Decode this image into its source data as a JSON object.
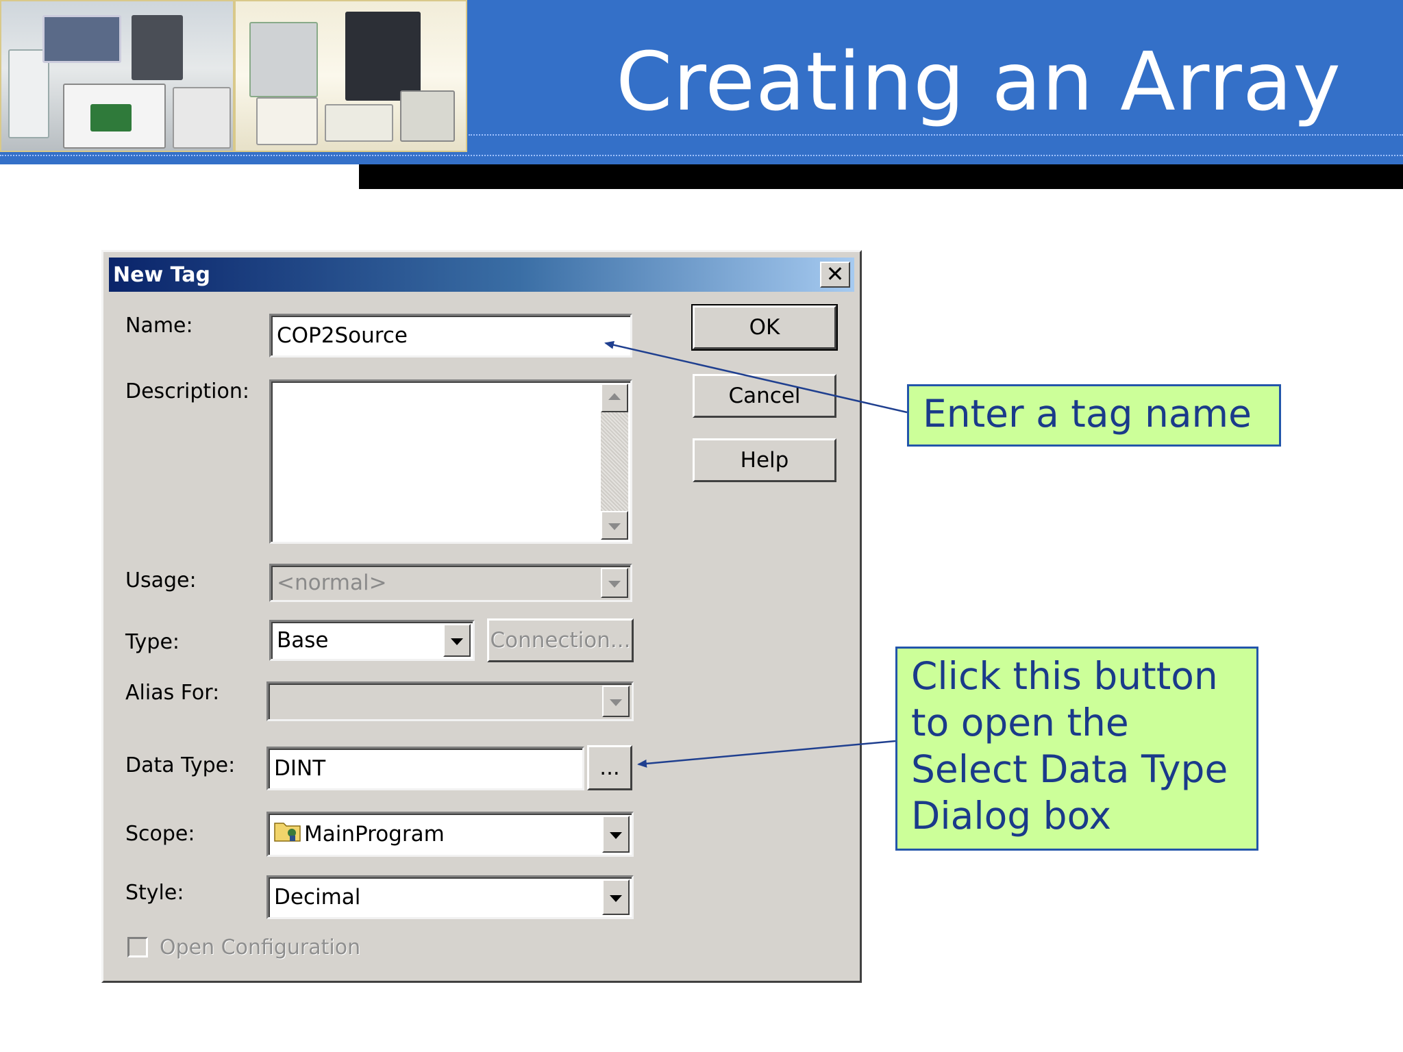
{
  "slide": {
    "title": "Creating an Array"
  },
  "dialog": {
    "title": "New Tag",
    "close_glyph": "✕",
    "labels": {
      "name": "Name:",
      "description": "Description:",
      "usage": "Usage:",
      "type": "Type:",
      "alias_for": "Alias For:",
      "data_type": "Data Type:",
      "scope": "Scope:",
      "style": "Style:"
    },
    "fields": {
      "name_value": "COP2Source",
      "description_value": "",
      "usage_value": "<normal>",
      "type_value": "Base",
      "alias_for_value": "",
      "data_type_value": "DINT",
      "scope_value": "MainProgram",
      "style_value": "Decimal"
    },
    "buttons": {
      "ok": "OK",
      "cancel": "Cancel",
      "help": "Help",
      "connection": "Connection...",
      "browse": "..."
    },
    "open_configuration": {
      "label": "Open Configuration",
      "checked": false
    }
  },
  "callouts": {
    "tag_name": "Enter a tag name",
    "data_type_button": [
      "Click this button",
      "to open the",
      "Select Data Type",
      "Dialog box"
    ]
  },
  "colors": {
    "header_blue": "#3470c8",
    "callout_fill": "#ccff99",
    "callout_text": "#1a3a8a",
    "dialog_face": "#d6d3ce"
  }
}
